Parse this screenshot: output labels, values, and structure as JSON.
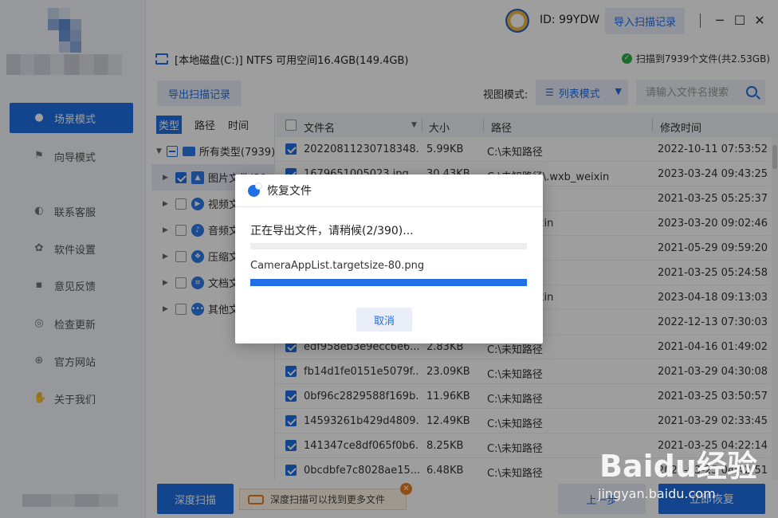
{
  "sidebar": {
    "items": [
      {
        "label": "场景模式",
        "icon": "scene-icon",
        "active": true
      },
      {
        "label": "向导模式",
        "icon": "flag-icon",
        "active": false
      },
      {
        "label": "联系客服",
        "icon": "headset-icon",
        "active": false
      },
      {
        "label": "软件设置",
        "icon": "gear-icon",
        "active": false
      },
      {
        "label": "意见反馈",
        "icon": "chat-icon",
        "active": false
      },
      {
        "label": "检查更新",
        "icon": "refresh-icon",
        "active": false
      },
      {
        "label": "官方网站",
        "icon": "globe-icon",
        "active": false
      },
      {
        "label": "关于我们",
        "icon": "handshake-icon",
        "active": false
      }
    ]
  },
  "header": {
    "user_id": "ID: 99YDW",
    "import_label": "导入扫描记录",
    "window_controls": [
      "─",
      "☐",
      "✕"
    ]
  },
  "disk": {
    "info": "[本地磁盘(C:)] NTFS 可用空间16.4GB(149.4GB)",
    "scan_result": "扫描到7939个文件(共2.53GB)"
  },
  "toolbar": {
    "export_label": "导出扫描记录",
    "view_label": "视图模式:",
    "view_value": "列表模式",
    "search_placeholder": "请输入文件名搜索"
  },
  "tree": {
    "tabs": [
      "类型",
      "路径",
      "时间"
    ],
    "root": "所有类型(7939)",
    "items": [
      {
        "label": "图片文件(39",
        "icon": "image-icon",
        "checked": true
      },
      {
        "label": "视频文",
        "icon": "video-icon",
        "checked": false
      },
      {
        "label": "音频文",
        "icon": "music-icon",
        "checked": false
      },
      {
        "label": "压缩文",
        "icon": "archive-icon",
        "checked": false
      },
      {
        "label": "文档文",
        "icon": "document-icon",
        "checked": false
      },
      {
        "label": "其他文",
        "icon": "more-icon",
        "checked": false
      }
    ]
  },
  "table": {
    "headers": {
      "name": "文件名",
      "size": "大小",
      "path": "路径",
      "time": "修改时间"
    },
    "rows": [
      {
        "name": "20220811230718348...",
        "size": "5.99KB",
        "path": "C:\\未知路径",
        "time": "2022-10-11 07:53:52"
      },
      {
        "name": "1679651005023.jpg",
        "size": "30.43KB",
        "path": "C:\\未知路径\\.wxb_weixin",
        "time": "2023-03-24 09:43:25"
      },
      {
        "name": "",
        "size": "",
        "path": "",
        "time": "2021-03-25 05:25:37"
      },
      {
        "name": "",
        "size": "",
        "path": "\\.wxb_weixin",
        "time": "2023-03-20 09:02:46"
      },
      {
        "name": "",
        "size": "",
        "path": "",
        "time": "2021-05-29 09:59:20"
      },
      {
        "name": "",
        "size": "",
        "path": "",
        "time": "2021-03-25 05:24:58"
      },
      {
        "name": "",
        "size": "",
        "path": "\\.wxb_weixin",
        "time": "2023-04-18 09:13:03"
      },
      {
        "name": "",
        "size": "",
        "path": "",
        "time": "2022-12-13 07:30:03"
      },
      {
        "name": "edf958eb3e9ecc6e6...",
        "size": "2.83KB",
        "path": "C:\\未知路径",
        "time": "2021-04-16 01:49:02"
      },
      {
        "name": "fb14d1fe0151e5079f...",
        "size": "23.09KB",
        "path": "C:\\未知路径",
        "time": "2021-03-29 04:30:08"
      },
      {
        "name": "0bf96c2829588f169b...",
        "size": "11.96KB",
        "path": "C:\\未知路径",
        "time": "2021-03-25 03:50:57"
      },
      {
        "name": "14593261b429d4809...",
        "size": "12.49KB",
        "path": "C:\\未知路径",
        "time": "2021-03-29 02:33:45"
      },
      {
        "name": "141347ce8df065f0b6...",
        "size": "8.25KB",
        "path": "C:\\未知路径",
        "time": "2021-03-25 04:22:14"
      },
      {
        "name": "0bcdbfe7c8028ae15...",
        "size": "6.48KB",
        "path": "C:\\未知路径",
        "time": "2021-03-25 04:42:51"
      }
    ]
  },
  "bottom": {
    "deep_scan_label": "深度扫描",
    "tip": "深度扫描可以找到更多文件",
    "prev_label": "上一步",
    "recover_label": "立即恢复"
  },
  "dialog": {
    "title": "恢复文件",
    "status": "正在导出文件，请稍候(2/390)...",
    "overall_progress": 0,
    "current_file": "CameraAppList.targetsize-80.png",
    "file_progress": 1.0,
    "cancel_label": "取消"
  },
  "watermark": {
    "text": "Baidu经验",
    "url": "jingyan.baidu.com"
  },
  "colors": {
    "accent": "#1f6fe6",
    "success": "#2bb04a",
    "warning": "#e67e22"
  }
}
